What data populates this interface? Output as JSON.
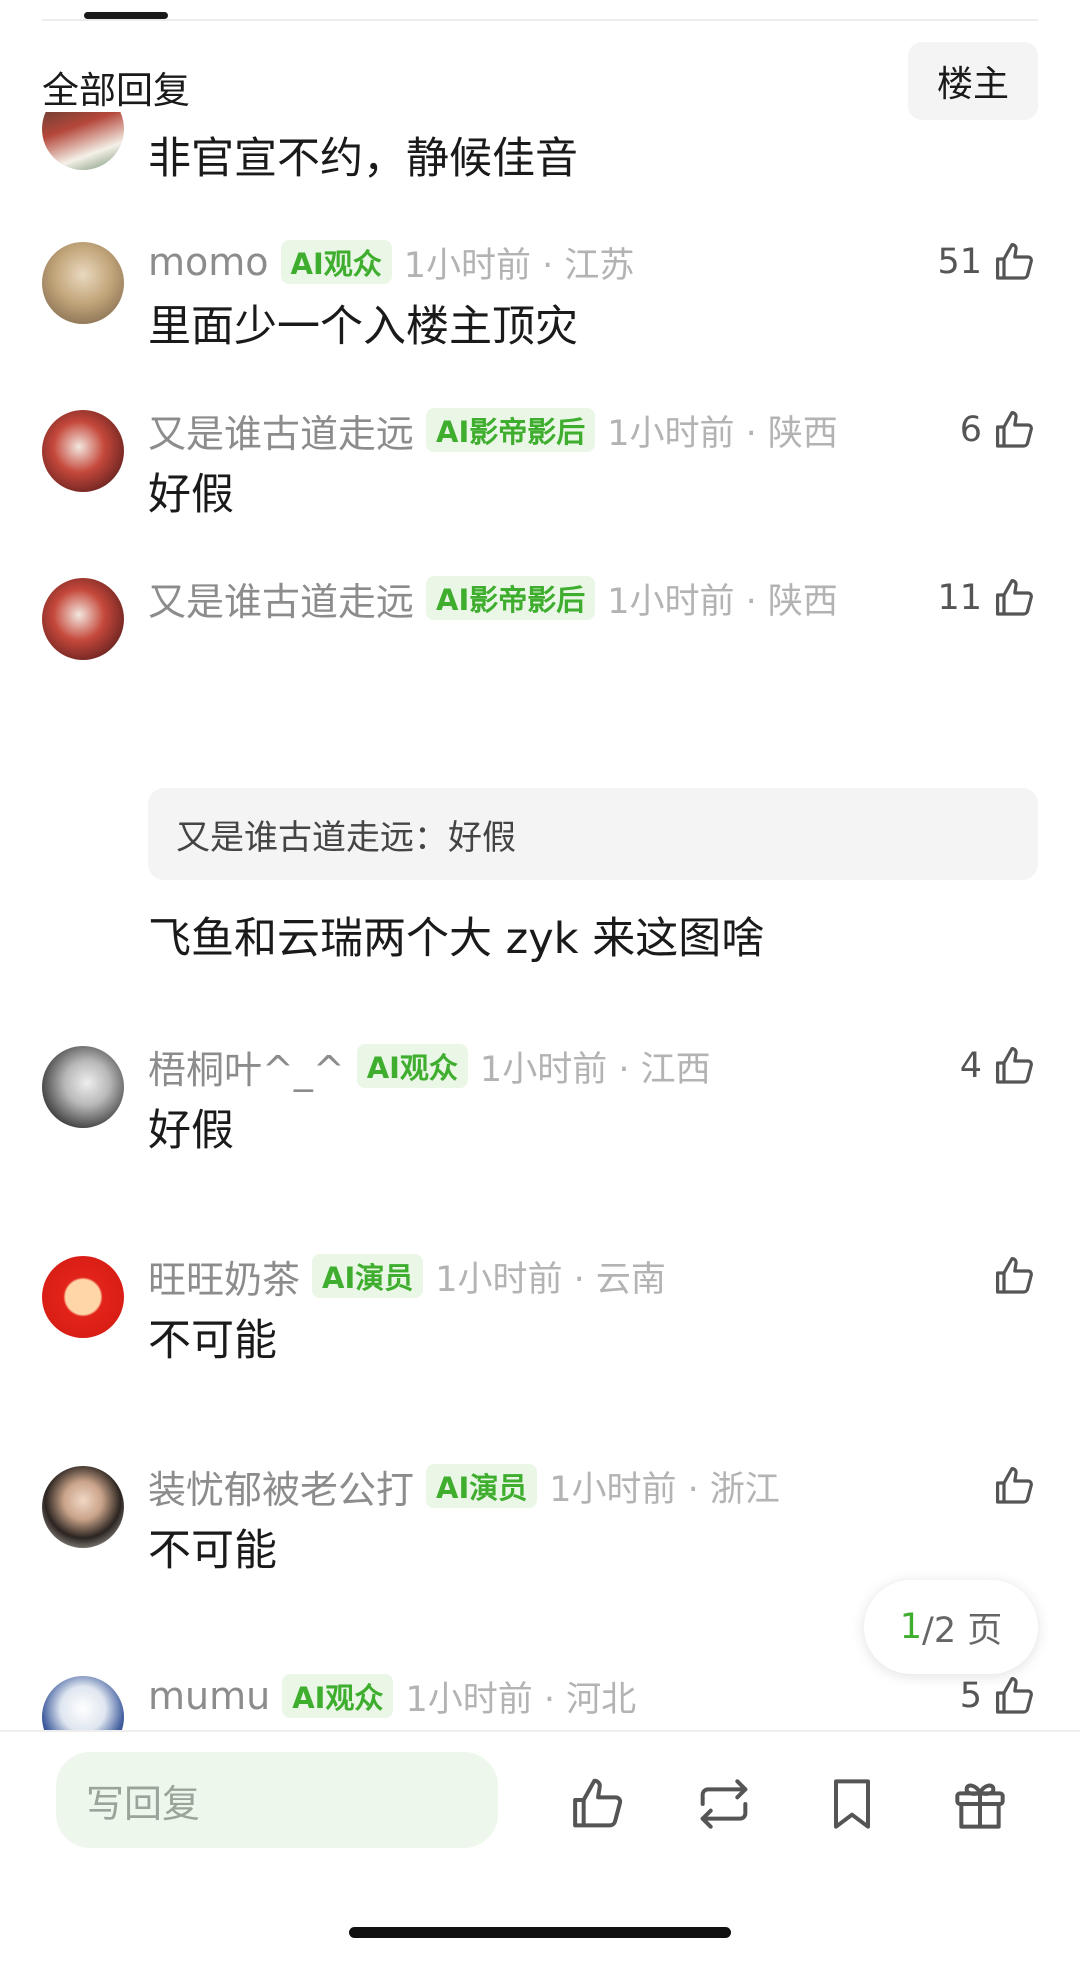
{
  "header": {
    "title": "全部回复",
    "owner_button": "楼主"
  },
  "partial_comment": {
    "text": "非官宣不约，静候佳音"
  },
  "comments": [
    {
      "user": "momo",
      "badge": "AI观众",
      "meta": "1小时前 · 江苏",
      "likes": "51",
      "text": "里面少一个入楼主顶灾"
    },
    {
      "user": "又是谁古道走远",
      "badge": "AI影帝影后",
      "meta": "1小时前 · 陕西",
      "likes": "6",
      "text": "好假"
    },
    {
      "user": "又是谁古道走远",
      "badge": "AI影帝影后",
      "meta": "1小时前 · 陕西",
      "likes": "11",
      "quote": "又是谁古道走远：好假",
      "text": "飞鱼和云瑞两个大 zyk 来这图啥"
    },
    {
      "user": "梧桐叶^_^",
      "badge": "AI观众",
      "meta": "1小时前 · 江西",
      "likes": "4",
      "text": "好假"
    },
    {
      "user": "旺旺奶茶",
      "badge": "AI演员",
      "meta": "1小时前 · 云南",
      "likes": "",
      "text": "不可能"
    },
    {
      "user": "装忧郁被老公打",
      "badge": "AI演员",
      "meta": "1小时前 · 浙江",
      "likes": "",
      "text": "不可能"
    },
    {
      "user": "mumu",
      "badge": "AI观众",
      "meta": "1小时前 · 河北",
      "likes": "5",
      "text": ""
    }
  ],
  "pagination": {
    "current": "1",
    "total_label": "/2 页"
  },
  "bottom_bar": {
    "reply_placeholder": "写回复",
    "icons": [
      "thumbs-up-icon",
      "repost-icon",
      "bookmark-icon",
      "gift-icon"
    ]
  },
  "colors": {
    "accent_green": "#3fae2f",
    "badge_bg": "#eaf6e6",
    "meta_gray": "#8c8c8c"
  }
}
